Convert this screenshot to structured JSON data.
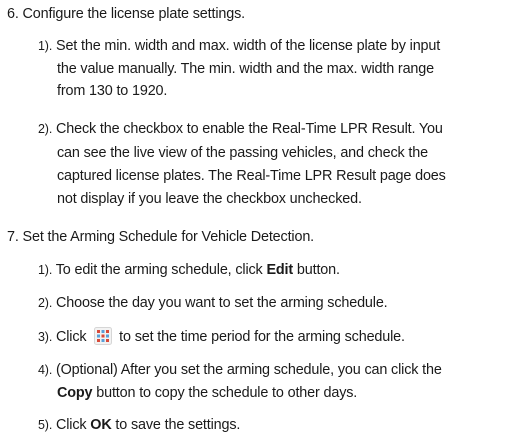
{
  "step6": {
    "title": "6. Configure the license plate settings.",
    "sub1": {
      "num": "1).",
      "lines": [
        "Set the min. width and max. width of the license plate by input",
        "the value manually. The min. width and the max. width range",
        "from 130 to 1920."
      ]
    },
    "sub2": {
      "num": "2).",
      "lines": [
        "Check the checkbox to enable the Real-Time LPR Result. You",
        "can see the live view of the passing vehicles, and check the",
        "captured license plates. The Real-Time LPR Result page does",
        "not display if you leave the checkbox unchecked."
      ]
    }
  },
  "step7": {
    "title": "7. Set the Arming Schedule for Vehicle Detection.",
    "sub1": {
      "num": "1).",
      "pre": "To edit the arming schedule, click ",
      "bold": "Edit",
      "post": " button."
    },
    "sub2": {
      "num": "2).",
      "text": "Choose the day you want to set the arming schedule."
    },
    "sub3": {
      "num": "3).",
      "pre": "Click",
      "icon": "time-period-icon",
      "post": "to set the time period for the arming schedule."
    },
    "sub4": {
      "num": "4).",
      "line1": "(Optional) After you set the arming schedule, you can click the",
      "bold": "Copy",
      "post": " button to copy the schedule to other days."
    },
    "sub5": {
      "num": "5).",
      "pre": "Click ",
      "bold": "OK",
      "post": " to save the settings."
    }
  }
}
